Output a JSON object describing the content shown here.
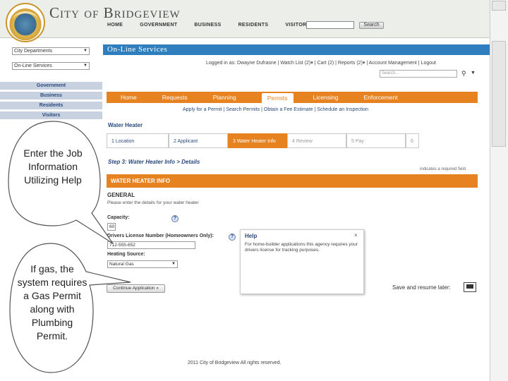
{
  "header": {
    "site_title": "City of Bridgeview",
    "nav": [
      "HOME",
      "GOVERNMENT",
      "BUSINESS",
      "RESIDENTS",
      "VISITORS"
    ],
    "search_button": "Search"
  },
  "sidebar": {
    "dropdowns": [
      "City Departments",
      "On-Line Services"
    ],
    "items": [
      "Government",
      "Business",
      "Residents",
      "Visitors"
    ]
  },
  "online_services": {
    "title": "On-Line Services",
    "utility_bar": "Logged in as: Dwayne Dufrasne | Watch List (2)▾ | Cart (2) | Reports (2)▾ | Account Management | Logout",
    "search_placeholder": "Search..."
  },
  "tabs": [
    "Home",
    "Requests",
    "Planning",
    "Permits",
    "Licensing",
    "Enforcement"
  ],
  "active_tab": "Permits",
  "subtabs": "Apply for a Permit | Search Permits | Obtain a Fee Estimate | Schedule an Inspection",
  "form": {
    "section_title": "Water Heater",
    "steps": [
      "1  Location",
      "2  Applicant",
      "3  Water Heater Info",
      "4  Review",
      "5  Pay",
      "6"
    ],
    "step_title": "Step 3: Water Heater Info > Details",
    "required_note": "indicates a required field",
    "bar_title": "WATER HEATER INFO",
    "general_heading": "GENERAL",
    "general_desc": "Please enter the details for your water heater",
    "capacity_label": "Capacity:",
    "capacity_value": "60",
    "license_label": "Drivers License Number (Homeowners Only):",
    "license_value": "712-555-652",
    "heating_label": "Heating Source:",
    "heating_value": "Natural Gas",
    "continue_button": "Continue Application »",
    "save_resume": "Save and resume later:"
  },
  "help_popup": {
    "title": "Help",
    "text": "For home-builder applications this agency requires your drivers license for tracking purposes.",
    "close": "×"
  },
  "footer": "2011 City of Bridgeview All rights reserved.",
  "callouts": {
    "top": "Enter the Job Information Utilizing Help",
    "bottom": "If gas, the system requires a Gas Permit along with Plumbing Permit."
  }
}
